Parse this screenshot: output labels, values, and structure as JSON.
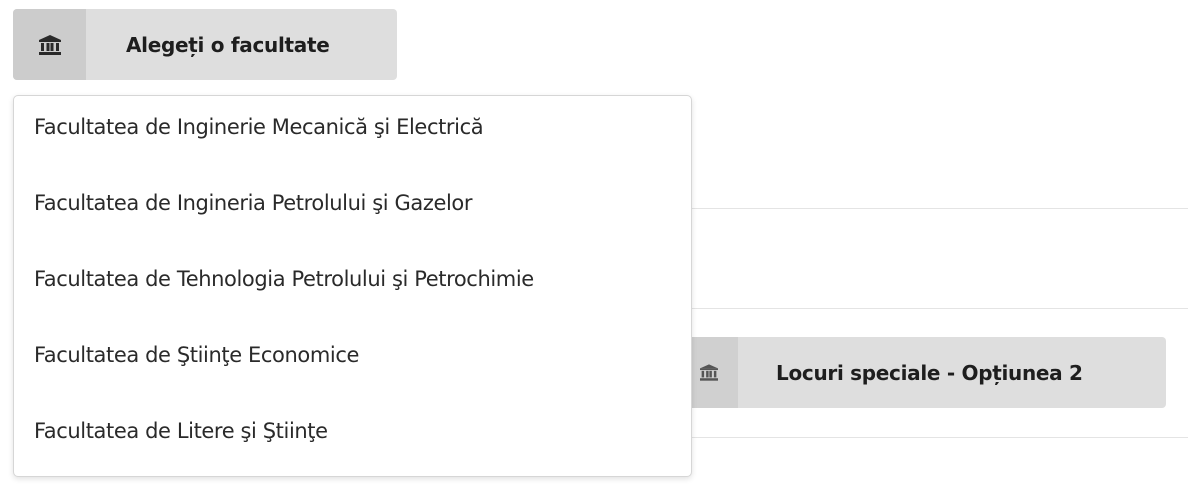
{
  "faculty_select": {
    "icon": "bank-icon",
    "label": "Alegeți o facultate"
  },
  "dropdown": {
    "items": [
      "Facultatea de Inginerie Mecanică şi Electrică",
      "Facultatea de Ingineria Petrolului şi Gazelor",
      "Facultatea de Tehnologia Petrolului şi Petrochimie",
      "Facultatea de Ştiinţe Economice",
      "Facultatea de Litere şi Ştiinţe"
    ]
  },
  "special_places_button": {
    "icon": "bank-icon",
    "label": "Locuri speciale - Opțiunea 2"
  },
  "colors": {
    "button_bg": "#dedede",
    "icon_box_bg": "#cccccc",
    "dropdown_border": "#d6d6d6",
    "divider": "#e4e4e4"
  }
}
